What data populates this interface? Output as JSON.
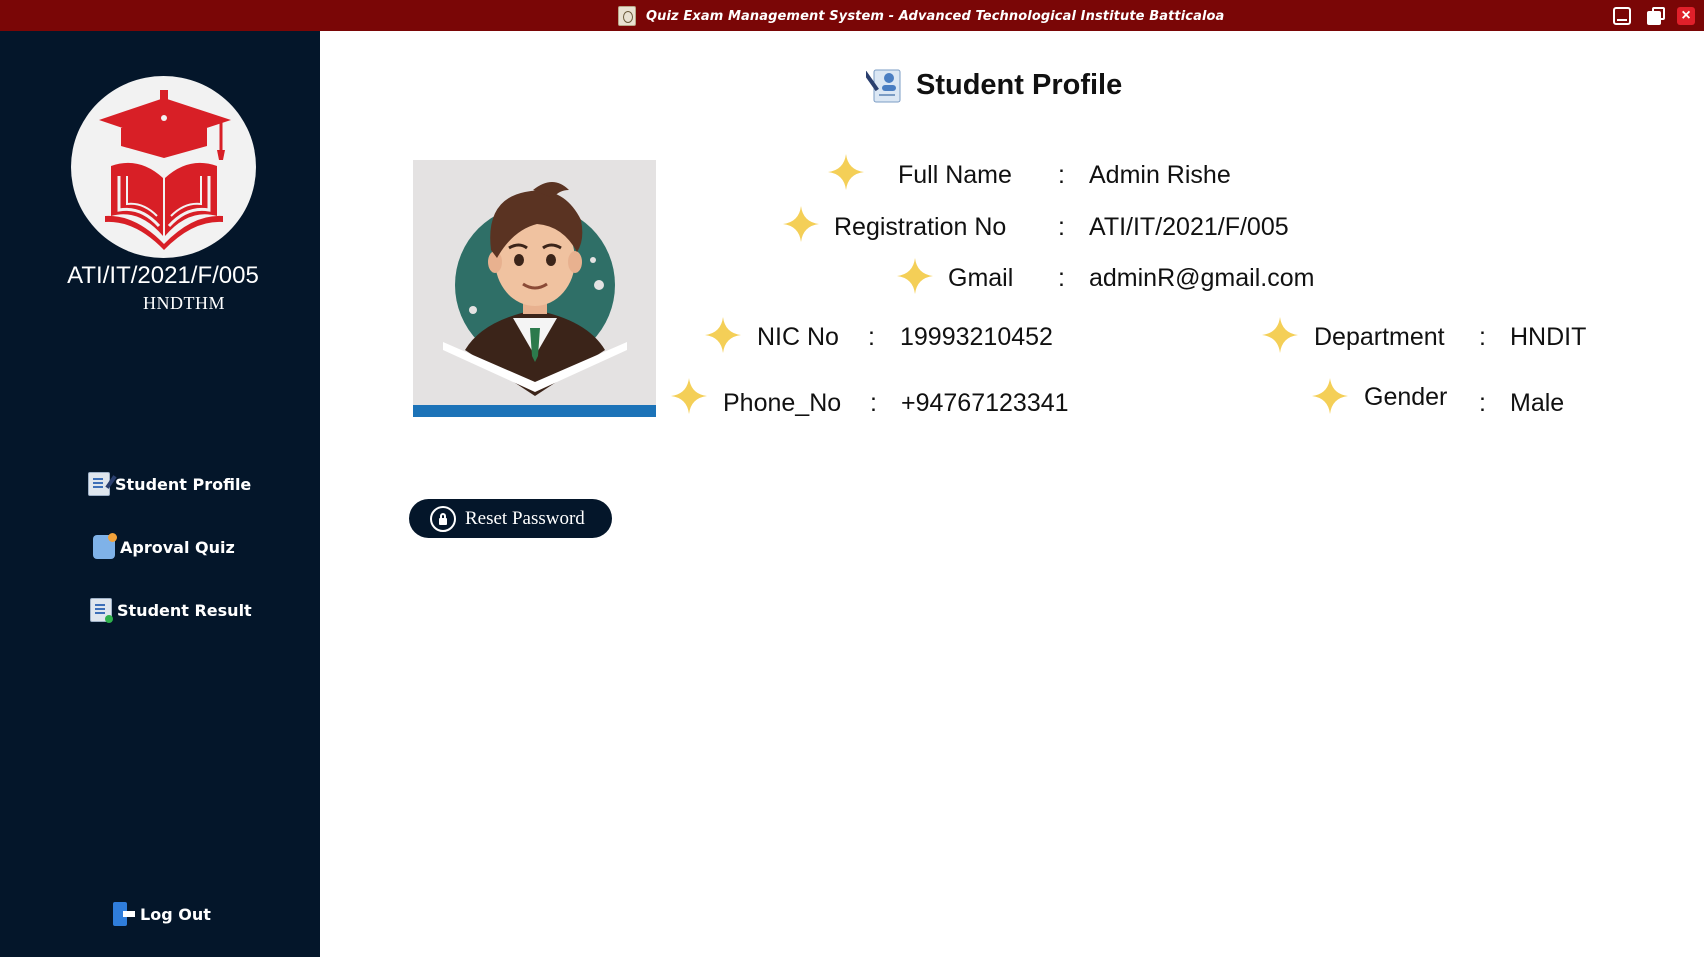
{
  "window": {
    "title": "Quiz Exam Management System - Advanced Technological Institute  Batticaloa",
    "buttons": [
      "minimize-icon",
      "maximize-icon",
      "close-icon"
    ]
  },
  "sidebar": {
    "registration_no": "ATI/IT/2021/F/005",
    "course": "HNDTHM",
    "nav": [
      {
        "label": "Student Profile",
        "icon": "profile-doc-icon"
      },
      {
        "label": "Aproval Quiz",
        "icon": "quiz-icon"
      },
      {
        "label": "Student Result",
        "icon": "result-clipboard-icon"
      }
    ],
    "logout_label": "Log Out"
  },
  "main": {
    "title": "Student Profile",
    "fields": {
      "full_name": {
        "label": "Full Name",
        "value": "Admin Rishe"
      },
      "registration_no": {
        "label": "Registration No",
        "value": "ATI/IT/2021/F/005"
      },
      "gmail": {
        "label": "Gmail",
        "value": "adminR@gmail.com"
      },
      "nic_no": {
        "label": "NIC No",
        "value": "19993210452"
      },
      "phone_no": {
        "label": "Phone_No",
        "value": "+94767123341"
      },
      "department": {
        "label": "Department",
        "value": "HNDIT"
      },
      "gender": {
        "label": "Gender",
        "value": "Male"
      }
    },
    "separator": ":",
    "reset_password_label": "Reset Password"
  },
  "colors": {
    "titlebar": "#7a0606",
    "sidebar": "#04162a",
    "accent_red": "#d81f26",
    "star": "#f4cf57"
  }
}
